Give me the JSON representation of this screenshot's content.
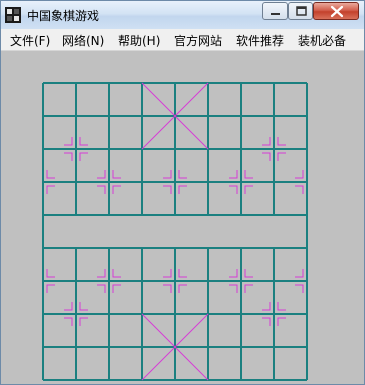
{
  "window": {
    "title": "中国象棋游戏",
    "icon": "chess-app-icon",
    "buttons": {
      "minimize": "minimize-icon",
      "maximize": "maximize-icon",
      "close": "close-icon"
    }
  },
  "menu": {
    "items": [
      {
        "label": "文件(F)"
      },
      {
        "label": "网络(N)"
      },
      {
        "label": "帮助(H)"
      },
      {
        "label": "官方网站"
      },
      {
        "label": "软件推荐"
      },
      {
        "label": "装机必备"
      }
    ]
  },
  "board": {
    "type": "xiangqi",
    "files": 9,
    "ranks": 10,
    "river_text": "",
    "colors": {
      "background": "#c0c0c0",
      "grid": "#1b8080",
      "palace": "#d63cd6",
      "markers": "#d63cd6"
    }
  }
}
